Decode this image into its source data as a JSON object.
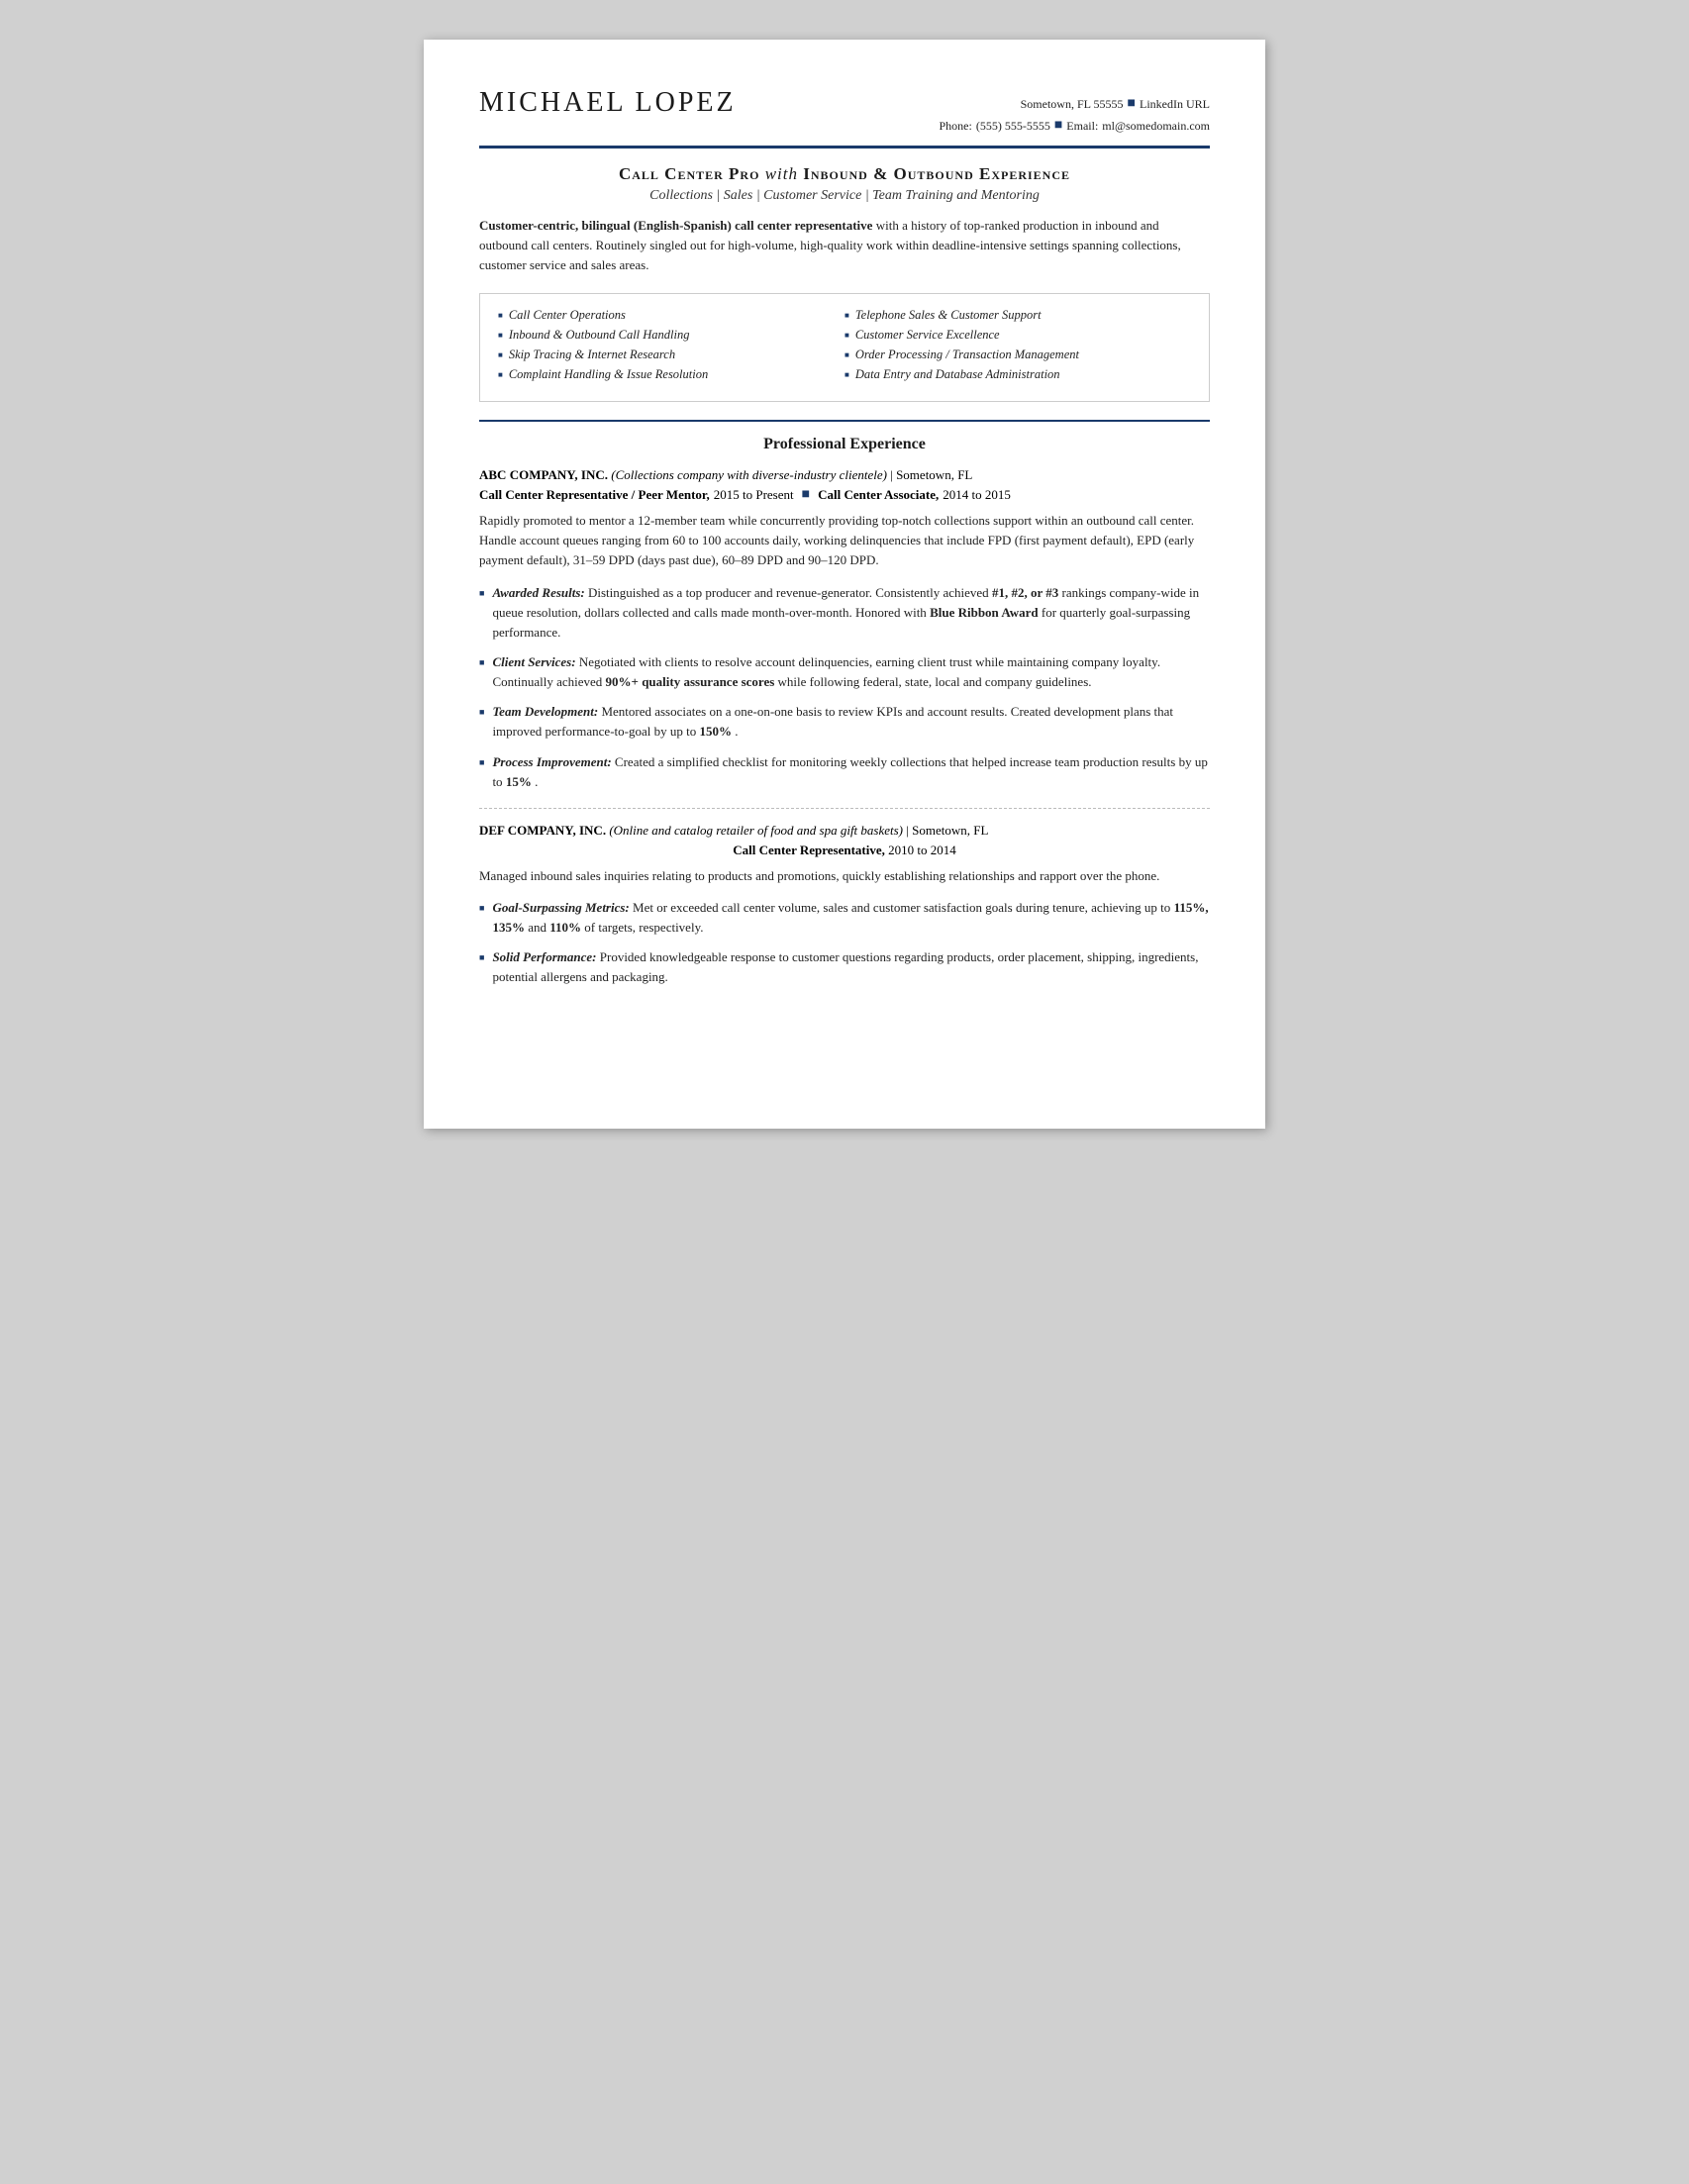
{
  "header": {
    "name": "Michael Lopez",
    "contact": {
      "line1_city": "Sometown, FL 55555",
      "line1_linkedin": "LinkedIn URL",
      "line2_phone_label": "Phone:",
      "line2_phone": "(555) 555-5555",
      "line2_email_label": "Email:",
      "line2_email": "ml@somedomain.com"
    }
  },
  "title": {
    "main": "Call Center Pro",
    "italic_connector": "with",
    "main2": "Inbound & Outbound Experience",
    "subtitle": "Collections | Sales | Customer Service | Team Training and Mentoring"
  },
  "summary": {
    "bold_part": "Customer-centric, bilingual (English-Spanish) call center representative",
    "rest": " with a history of top-ranked production in inbound and outbound call centers. Routinely singled out for high-volume, high-quality work within deadline-intensive settings spanning collections, customer service and sales areas."
  },
  "skills": {
    "left": [
      "Call Center Operations",
      "Inbound & Outbound Call Handling",
      "Skip Tracing & Internet Research",
      "Complaint Handling & Issue Resolution"
    ],
    "right": [
      "Telephone Sales & Customer Support",
      "Customer Service Excellence",
      "Order Processing / Transaction Management",
      "Data Entry and Database Administration"
    ]
  },
  "professional_experience": {
    "section_title": "Professional Experience",
    "companies": [
      {
        "name": "ABC COMPANY, INC.",
        "description": "(Collections company with diverse-industry clientele)",
        "location": "Sometown, FL",
        "roles": [
          {
            "title": "Call Center Representative / Peer Mentor,",
            "dates": "2015 to Present",
            "title2": "Call Center Associate,",
            "dates2": "2014 to 2015"
          }
        ],
        "body": "Rapidly promoted to mentor a 12-member team while concurrently providing top-notch collections support within an outbound call center. Handle account queues ranging from 60 to 100 accounts daily, working delinquencies that include FPD (first payment default), EPD (early payment default), 31–59 DPD (days past due), 60–89 DPD and 90–120 DPD.",
        "bullets": [
          {
            "label": "Awarded Results:",
            "text": "Distinguished as a top producer and revenue-generator. Consistently achieved ",
            "bold_middle": "#1, #2, or #3",
            "text2": " rankings company-wide in queue resolution, dollars collected and calls made month-over-month. Honored with ",
            "bold_end": "Blue Ribbon Award",
            "text3": " for quarterly goal-surpassing performance."
          },
          {
            "label": "Client Services:",
            "text": "Negotiated with clients to resolve account delinquencies, earning client trust while maintaining company loyalty. Continually achieved ",
            "bold_middle": "90%+ quality assurance scores",
            "text2": " while following federal, state, local and company guidelines.",
            "bold_end": "",
            "text3": ""
          },
          {
            "label": "Team Development:",
            "text": "Mentored associates on a one-on-one basis to review KPIs and account results. Created development plans that improved performance-to-goal by up to ",
            "bold_middle": "150%",
            "text2": ".",
            "bold_end": "",
            "text3": ""
          },
          {
            "label": "Process Improvement:",
            "text": "Created a simplified checklist for monitoring weekly collections that helped increase team production results by up to ",
            "bold_middle": "15%",
            "text2": ".",
            "bold_end": "",
            "text3": ""
          }
        ]
      },
      {
        "name": "DEF COMPANY, INC.",
        "description": "(Online and catalog retailer of food and spa gift baskets)",
        "location": "Sometown, FL",
        "roles": [
          {
            "title": "Call Center Representative,",
            "dates": "2010 to 2014",
            "title2": "",
            "dates2": ""
          }
        ],
        "body": "Managed inbound sales inquiries relating to products and promotions, quickly establishing relationships and rapport over the phone.",
        "bullets": [
          {
            "label": "Goal-Surpassing Metrics:",
            "text": "Met or exceeded call center volume, sales and customer satisfaction goals during tenure, achieving up to ",
            "bold_middle": "115%, 135%",
            "text2": " and ",
            "bold_end": "110%",
            "text3": " of targets, respectively."
          },
          {
            "label": "Solid Performance:",
            "text": "Provided knowledgeable response to customer questions regarding products, order placement, shipping, ingredients, potential allergens and packaging.",
            "bold_middle": "",
            "text2": "",
            "bold_end": "",
            "text3": ""
          }
        ]
      }
    ]
  }
}
